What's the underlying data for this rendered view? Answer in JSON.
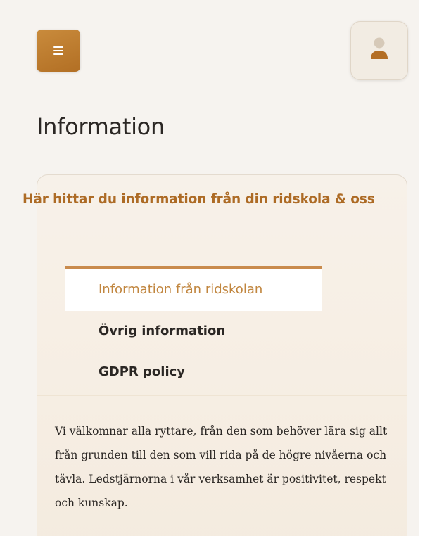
{
  "header": {
    "menu_icon": "hamburger-menu-icon",
    "user_icon": "user-icon",
    "accent_color": "#b87a30"
  },
  "page": {
    "title": "Information"
  },
  "card": {
    "heading": "Här hittar du information från din ridskola & oss",
    "tabs": [
      {
        "label": "Information från ridskolan",
        "active": true
      },
      {
        "label": "Övrig information",
        "active": false
      },
      {
        "label": "GDPR policy",
        "active": false
      }
    ],
    "body": "Vi välkomnar alla ryttare, från den som behöver lära sig allt från grunden till den som vill rida på de högre nivåerna och tävla. Ledstjärnorna i vår verksamhet är positivitet, respekt och kunskap."
  }
}
